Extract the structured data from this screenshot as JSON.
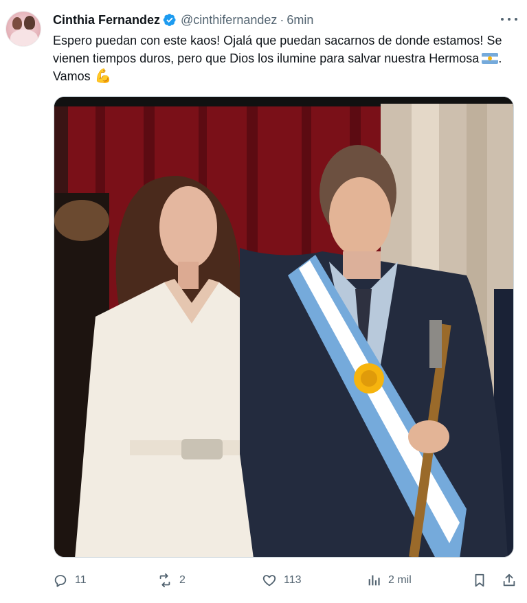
{
  "author": {
    "name": "Cinthia Fernandez",
    "handle": "@cinthifernandez",
    "separator": "·",
    "time": "6min"
  },
  "post": {
    "text_part1": "Espero puedan con este kaos!  Ojalá que puedan sacarnos de donde estamos! Se vienen tiempos duros, pero que Dios los ilumine para salvar nuestra Hermosa",
    "text_part2": ". Vamos",
    "flag_emoji": "argentina-flag-icon",
    "arm_emoji": "flexed-biceps-icon"
  },
  "actions": {
    "replies": "11",
    "reposts": "2",
    "likes": "113",
    "views": "2 mil"
  },
  "colors": {
    "verified": "#1d9bf0",
    "secondary_text": "#536471",
    "sash_blue": "#75aadb"
  }
}
